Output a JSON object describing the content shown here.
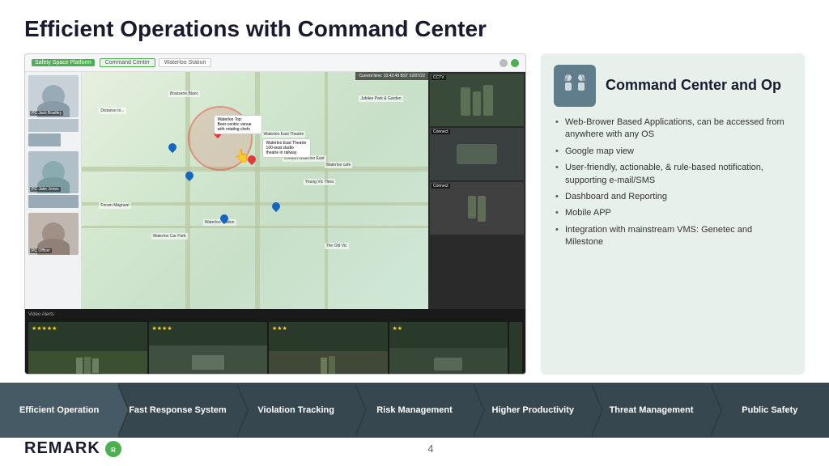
{
  "page": {
    "title": "Efficient Operations with Command Center",
    "footer_page": "4"
  },
  "logo": {
    "text": "REMARK",
    "symbol": "⓪"
  },
  "info_panel": {
    "title": "Command Center and Op",
    "bullets": [
      "Web-Brower Based Applications, can be accessed from anywhere with any OS",
      "Google map view",
      "User-friendly, actionable, & rule-based notification, supporting e-mail/SMS",
      "Dashboard and Reporting",
      "Mobile APP",
      "Integration with mainstream VMS: Genetec and Milestone"
    ]
  },
  "nav_items": [
    {
      "label": "Efficient Operation",
      "active": true
    },
    {
      "label": "Fast Response System",
      "active": false
    },
    {
      "label": "Violation Tracking",
      "active": false
    },
    {
      "label": "Risk Management",
      "active": false
    },
    {
      "label": "Higher Productivity",
      "active": false
    },
    {
      "label": "Threat Management",
      "active": false
    },
    {
      "label": "Public Safety",
      "active": false
    }
  ],
  "screenshot": {
    "logo_label": "Safety Space Platform",
    "tab1": "Command Center",
    "tab2": "Waterloo Station",
    "cam_labels": [
      "CCTV",
      "Connect",
      "Connect"
    ],
    "map_labels": [
      "Brasserie Blanc",
      "Waterloo East Theatre",
      "London Waterloo East",
      "Waterloo Station",
      "Waterloo cafe",
      "Young Vic Thea",
      "Forum Magnum",
      "Waterloo Car Park",
      "The Old Vic"
    ],
    "video_alerts_label": "Video Alerts",
    "strip_ratings": [
      "★★★★★",
      "★★★★",
      "★★★",
      "★★"
    ]
  }
}
